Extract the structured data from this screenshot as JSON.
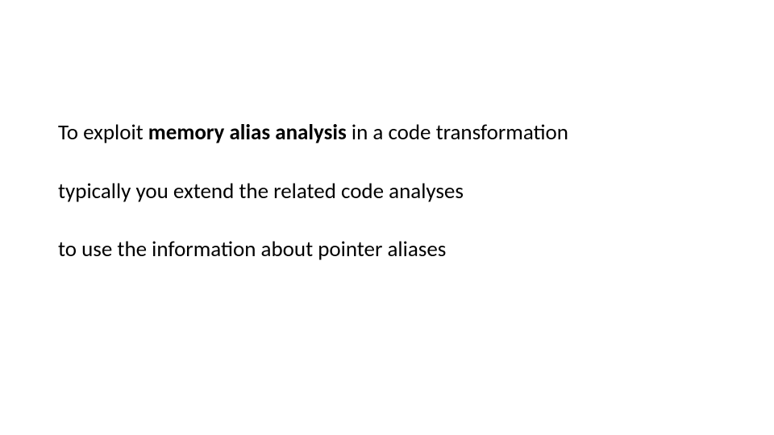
{
  "slide": {
    "line1": {
      "pre": "To exploit ",
      "bold": "memory alias analysis",
      "post": " in a code transformation"
    },
    "line2": "typically you extend the related code analyses",
    "line3": "to use the information about pointer aliases"
  }
}
